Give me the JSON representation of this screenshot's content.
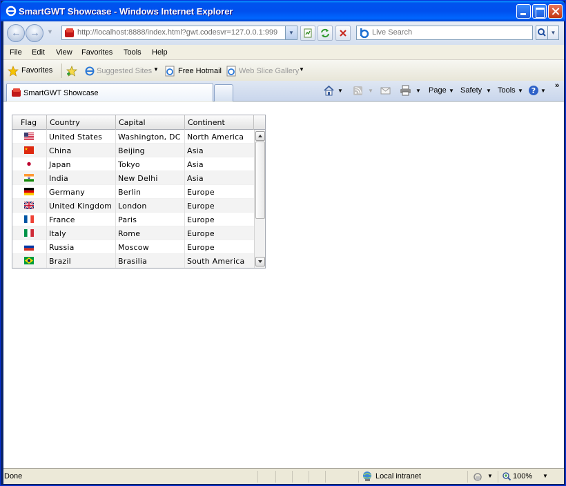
{
  "window": {
    "title": "SmartGWT Showcase - Windows Internet Explorer"
  },
  "address_bar": {
    "url_host": "http://localhost",
    "url_rest": ":8888/index.html?gwt.codesvr=127.0.0.1:999",
    "search_placeholder": "Live Search"
  },
  "menu": [
    "File",
    "Edit",
    "View",
    "Favorites",
    "Tools",
    "Help"
  ],
  "favorites_bar": {
    "favorites_label": "Favorites",
    "suggested_sites": "Suggested Sites",
    "free_hotmail": "Free Hotmail",
    "web_slice_gallery": "Web Slice Gallery"
  },
  "tabs": {
    "active_label": "SmartGWT Showcase"
  },
  "command_bar": {
    "page": "Page",
    "safety": "Safety",
    "tools": "Tools",
    "more": "»"
  },
  "grid": {
    "columns": [
      "Flag",
      "Country",
      "Capital",
      "Continent"
    ],
    "rows": [
      {
        "flag": "us",
        "country": "United States",
        "capital": "Washington, DC",
        "continent": "North America"
      },
      {
        "flag": "cn",
        "country": "China",
        "capital": "Beijing",
        "continent": "Asia"
      },
      {
        "flag": "jp",
        "country": "Japan",
        "capital": "Tokyo",
        "continent": "Asia"
      },
      {
        "flag": "in",
        "country": "India",
        "capital": "New Delhi",
        "continent": "Asia"
      },
      {
        "flag": "de",
        "country": "Germany",
        "capital": "Berlin",
        "continent": "Europe"
      },
      {
        "flag": "gb",
        "country": "United Kingdom",
        "capital": "London",
        "continent": "Europe"
      },
      {
        "flag": "fr",
        "country": "France",
        "capital": "Paris",
        "continent": "Europe"
      },
      {
        "flag": "it",
        "country": "Italy",
        "capital": "Rome",
        "continent": "Europe"
      },
      {
        "flag": "ru",
        "country": "Russia",
        "capital": "Moscow",
        "continent": "Europe"
      },
      {
        "flag": "br",
        "country": "Brazil",
        "capital": "Brasilia",
        "continent": "South America"
      }
    ]
  },
  "status_bar": {
    "status": "Done",
    "zone": "Local intranet",
    "zoom": "100%"
  }
}
